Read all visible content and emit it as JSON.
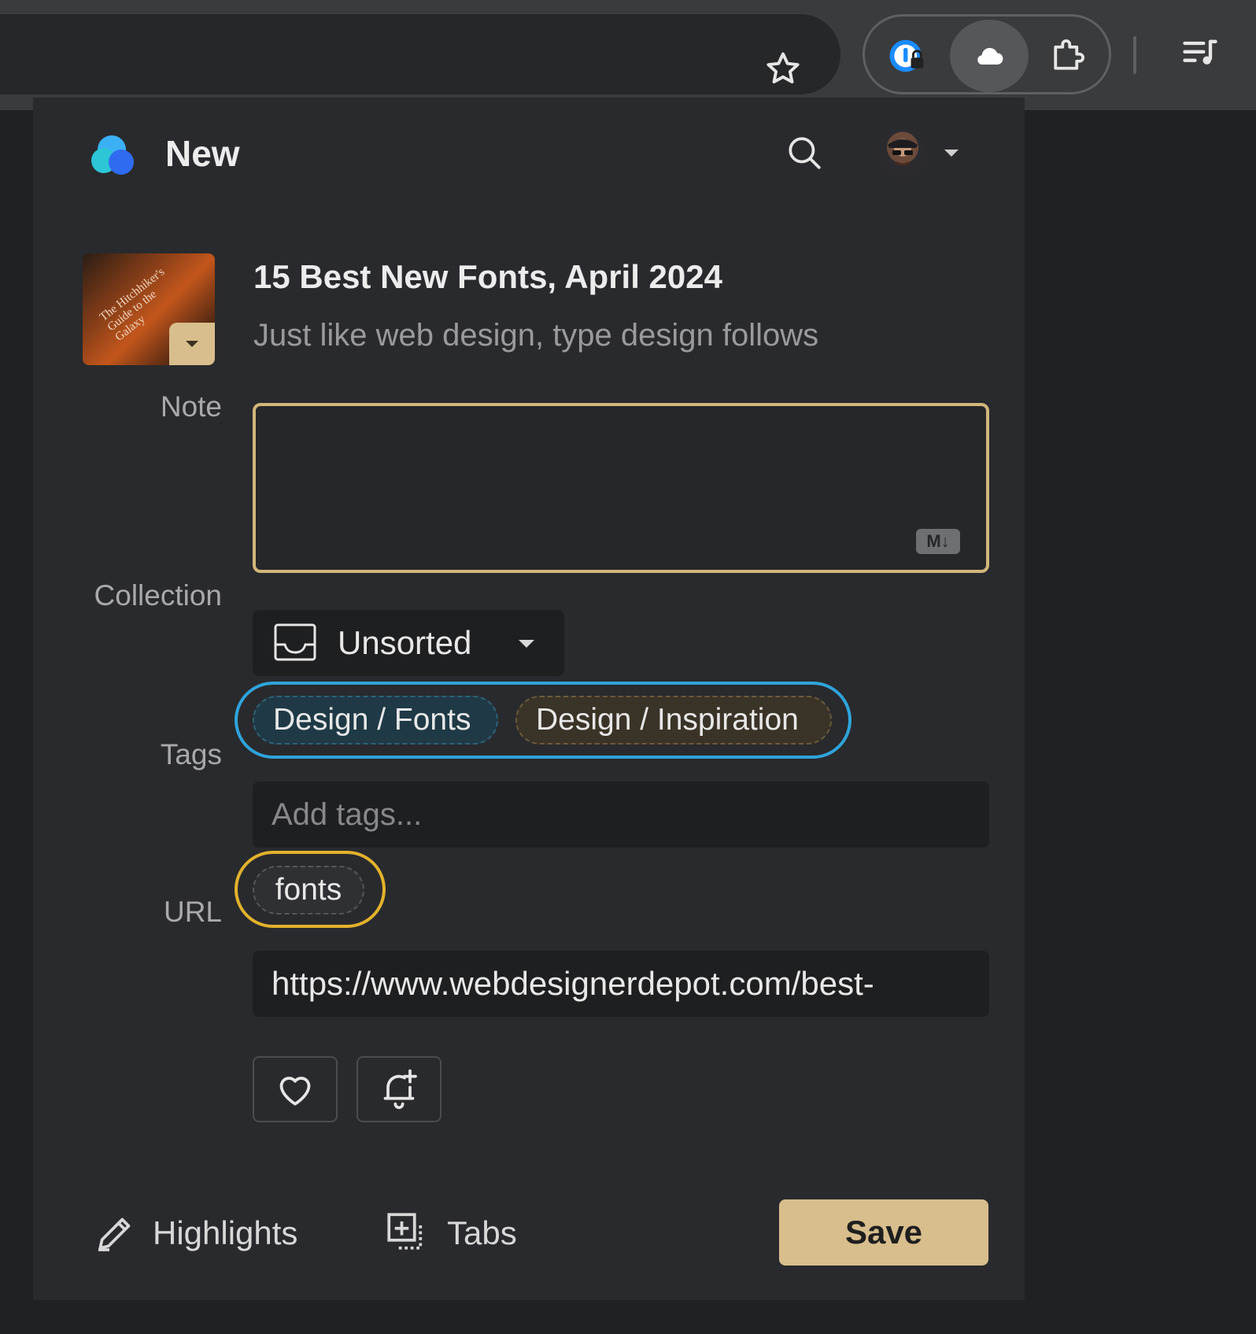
{
  "header": {
    "title": "New"
  },
  "item": {
    "thumbnail_text": "The Hitchhiker's Guide to the Galaxy",
    "title": "15 Best New Fonts, April 2024",
    "excerpt": "Just like web design, type design follows"
  },
  "form": {
    "note_label": "Note",
    "note_value": "",
    "markdown_badge": "M↓",
    "collection_label": "Collection",
    "collection_value": "Unsorted",
    "suggested_collections": [
      "Design / Fonts",
      "Design / Inspiration"
    ],
    "tags_label": "Tags",
    "tags_placeholder": "Add tags...",
    "tags": [
      "fonts"
    ],
    "url_label": "URL",
    "url_value": "https://www.webdesignerdepot.com/best-"
  },
  "footer": {
    "highlights_label": "Highlights",
    "tabs_label": "Tabs",
    "save_label": "Save"
  },
  "colors": {
    "accent": "#d8be8c",
    "focus_ring_blue": "#2fa4db",
    "focus_ring_yellow": "#e2b22c"
  }
}
